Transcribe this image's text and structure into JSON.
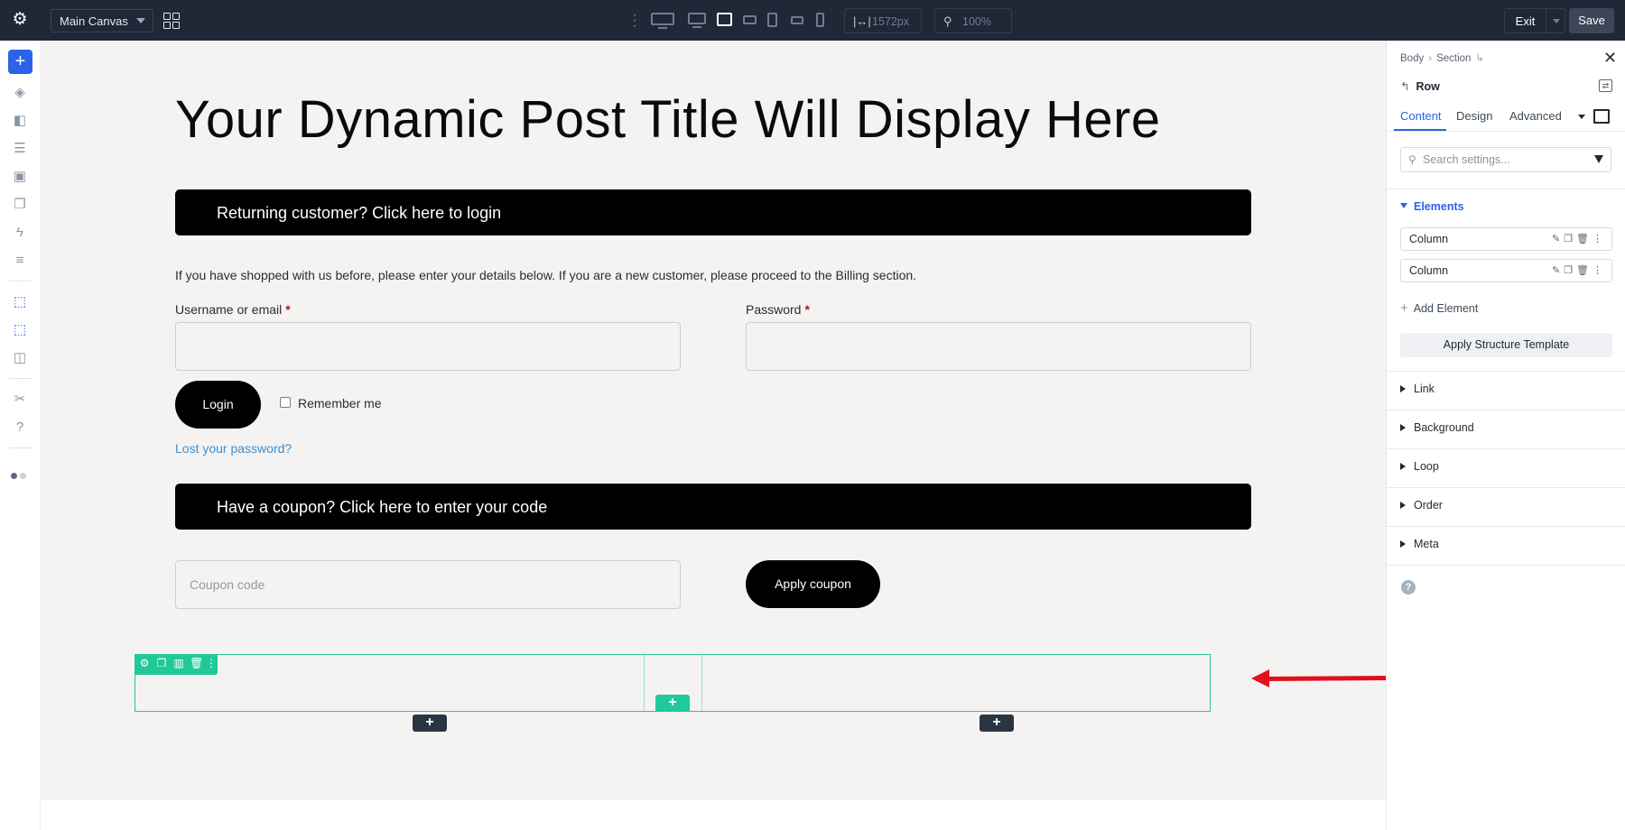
{
  "topbar": {
    "canvas_select": "Main Canvas",
    "width_value": "1572px",
    "zoom_value": "100%",
    "exit_label": "Exit",
    "save_label": "Save"
  },
  "canvas": {
    "post_title": "Your Dynamic Post Title Will Display Here",
    "login_notice": "Returning customer? Click here to login",
    "intro_text": "If you have shopped with us before, please enter your details below. If you are a new customer, please proceed to the Billing section.",
    "username_label": "Username or email",
    "password_label": "Password",
    "required_mark": "*",
    "login_button": "Login",
    "remember_me": "Remember me",
    "lost_password": "Lost your password?",
    "coupon_notice": "Have a coupon? Click here to enter your code",
    "coupon_placeholder": "Coupon code",
    "apply_coupon_button": "Apply coupon",
    "add_symbol": "+"
  },
  "panel": {
    "breadcrumb": [
      "Body",
      "Section"
    ],
    "element_title": "Row",
    "tabs": [
      "Content",
      "Design",
      "Advanced"
    ],
    "search_placeholder": "Search settings...",
    "elements_heading": "Elements",
    "elements": [
      {
        "label": "Column"
      },
      {
        "label": "Column"
      }
    ],
    "add_element": "Add Element",
    "apply_template": "Apply Structure Template",
    "accordions": [
      "Link",
      "Background",
      "Loop",
      "Order",
      "Meta"
    ],
    "help_symbol": "?"
  },
  "colors": {
    "topbar_bg": "#1e2836",
    "accent_blue": "#2b63e8",
    "selection_green": "#20c997",
    "canvas_bg": "#f4f3f1",
    "annotation_red": "#e0101c"
  }
}
